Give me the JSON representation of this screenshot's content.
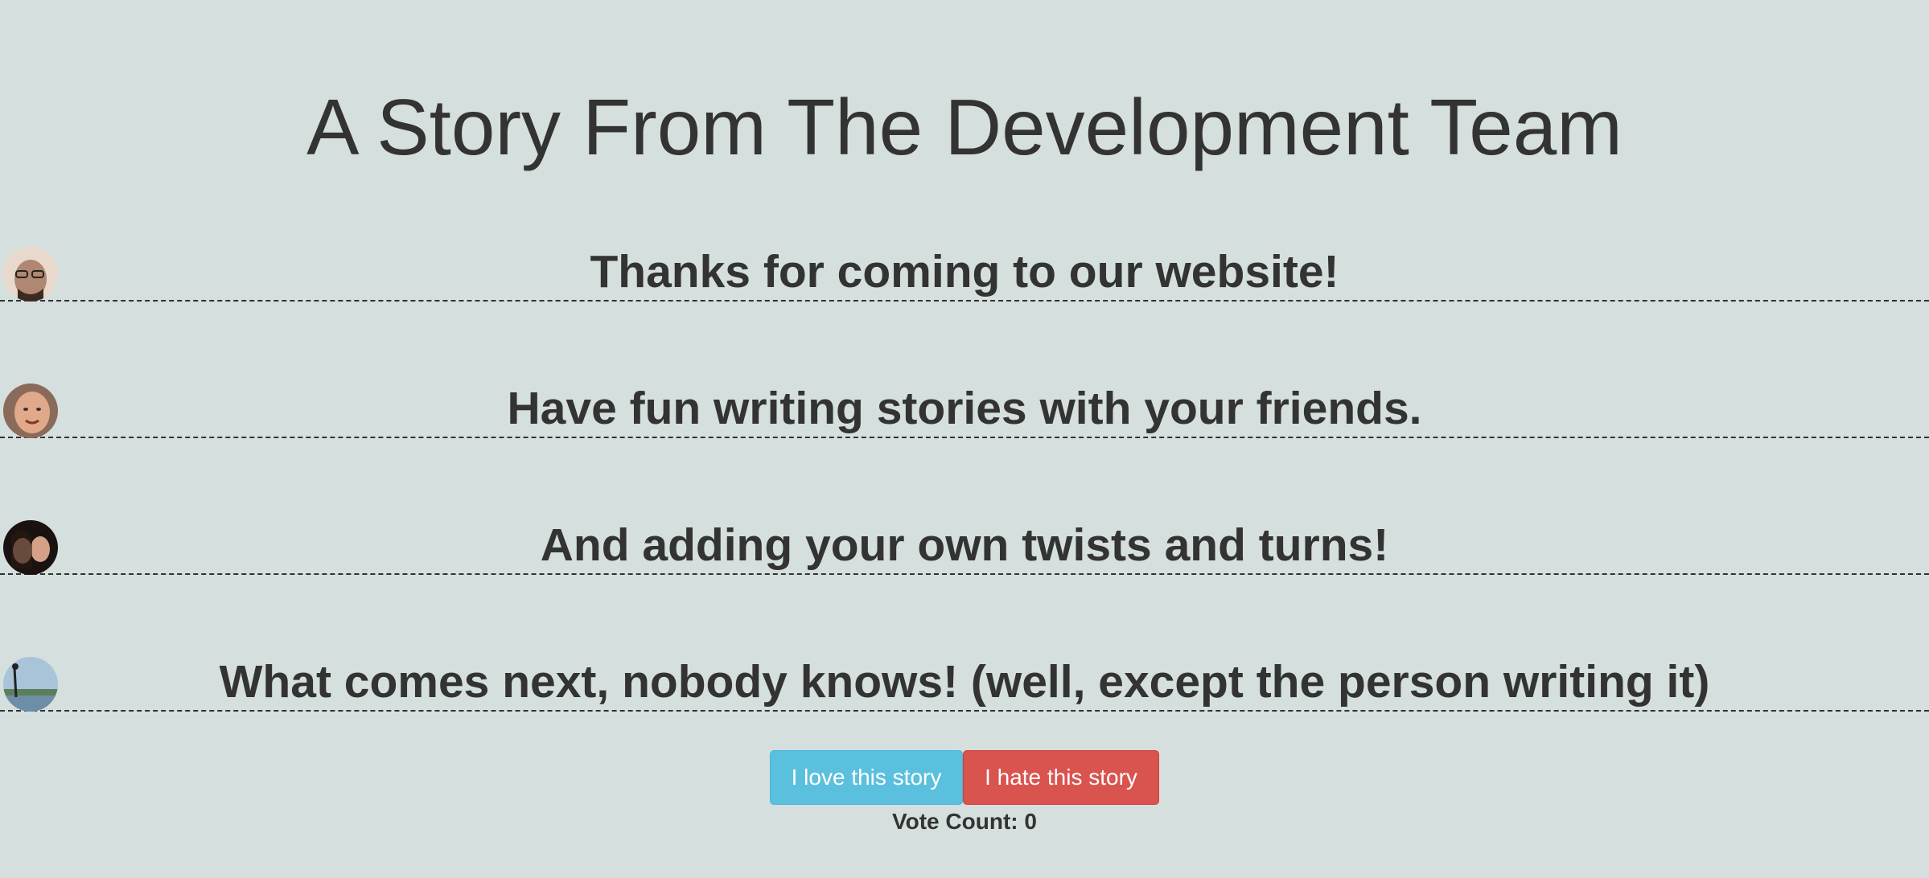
{
  "page": {
    "title": "A Story From The Development Team"
  },
  "story": {
    "lines": [
      {
        "text": "Thanks for coming to our website!",
        "avatar": "author-avatar-1"
      },
      {
        "text": "Have fun writing stories with your friends.",
        "avatar": "author-avatar-2"
      },
      {
        "text": "And adding your own twists and turns!",
        "avatar": "author-avatar-3"
      },
      {
        "text": "What comes next, nobody knows! (well, except the person writing it)",
        "avatar": "author-avatar-4"
      }
    ]
  },
  "actions": {
    "love_label": "I love this story",
    "hate_label": "I hate this story",
    "love_color": "#5bc0de",
    "hate_color": "#d9534f"
  },
  "votes": {
    "label": "Vote Count: 0"
  }
}
